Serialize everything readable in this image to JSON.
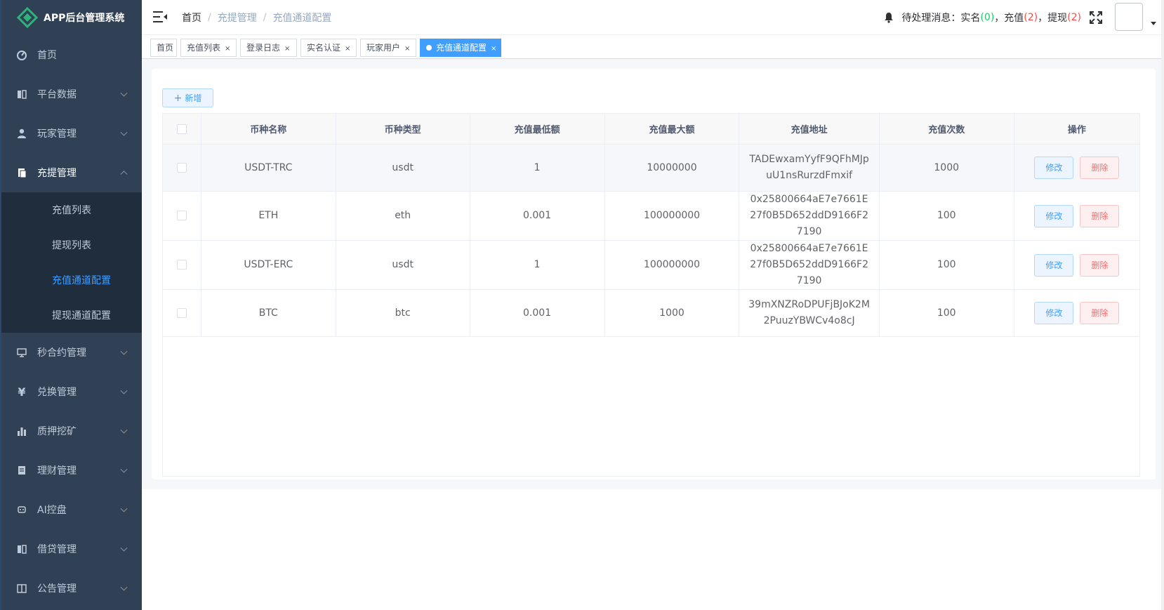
{
  "app": {
    "title": "APP后台管理系统"
  },
  "sidebar": {
    "items": [
      {
        "label": "首页",
        "icon": "dashboard-icon"
      },
      {
        "label": "平台数据",
        "icon": "book-icon"
      },
      {
        "label": "玩家管理",
        "icon": "user-icon"
      },
      {
        "label": "充提管理",
        "icon": "document-icon",
        "open": true,
        "children": [
          {
            "label": "充值列表"
          },
          {
            "label": "提现列表"
          },
          {
            "label": "充值通道配置",
            "active": true
          },
          {
            "label": "提现通道配置"
          }
        ]
      },
      {
        "label": "秒合约管理",
        "icon": "monitor-icon"
      },
      {
        "label": "兑换管理",
        "icon": "yen-icon"
      },
      {
        "label": "质押挖矿",
        "icon": "bar-chart-icon"
      },
      {
        "label": "理财管理",
        "icon": "file-icon"
      },
      {
        "label": "AI控盘",
        "icon": "robot-icon"
      },
      {
        "label": "借贷管理",
        "icon": "book-icon"
      },
      {
        "label": "公告管理",
        "icon": "notebook-icon"
      }
    ]
  },
  "navbar": {
    "breadcrumb": [
      "首页",
      "充提管理",
      "充值通道配置"
    ],
    "notice": {
      "prefix": "待处理消息：实名",
      "realname_count": "0",
      "recharge_label": "充值",
      "recharge_count": "2",
      "withdraw_label": "提现",
      "withdraw_count": "2"
    }
  },
  "tags": [
    {
      "label": "首页",
      "closable": false
    },
    {
      "label": "充值列表",
      "closable": true
    },
    {
      "label": "登录日志",
      "closable": true
    },
    {
      "label": "实名认证",
      "closable": true
    },
    {
      "label": "玩家用户",
      "closable": true
    },
    {
      "label": "充值通道配置",
      "closable": true,
      "active": true
    }
  ],
  "toolbar": {
    "add_label": "新增"
  },
  "table": {
    "headers": [
      "币种名称",
      "币种类型",
      "充值最低额",
      "充值最大额",
      "充值地址",
      "充值次数",
      "操作"
    ],
    "rows": [
      {
        "name": "USDT-TRC",
        "type": "usdt",
        "min": "1",
        "max": "10000000",
        "address": "TADEwxamYyfF9QFhMJpuU1nsRurzdFmxif",
        "count": "1000"
      },
      {
        "name": "ETH",
        "type": "eth",
        "min": "0.001",
        "max": "100000000",
        "address": "0x25800664aE7e7661E27f0B5D652ddD9166F27190",
        "count": "100"
      },
      {
        "name": "USDT-ERC",
        "type": "usdt",
        "min": "1",
        "max": "100000000",
        "address": "0x25800664aE7e7661E27f0B5D652ddD9166F27190",
        "count": "100"
      },
      {
        "name": "BTC",
        "type": "btc",
        "min": "0.001",
        "max": "1000",
        "address": "39mXNZRoDPUFjBJoK2M2PuuzYBWCv4o8cJ",
        "count": "100"
      }
    ],
    "edit_label": "修改",
    "delete_label": "删除"
  },
  "colors": {
    "sidebar_bg": "#304156",
    "accent": "#409eff",
    "danger": "#f56c6c",
    "success": "#13ce66"
  }
}
